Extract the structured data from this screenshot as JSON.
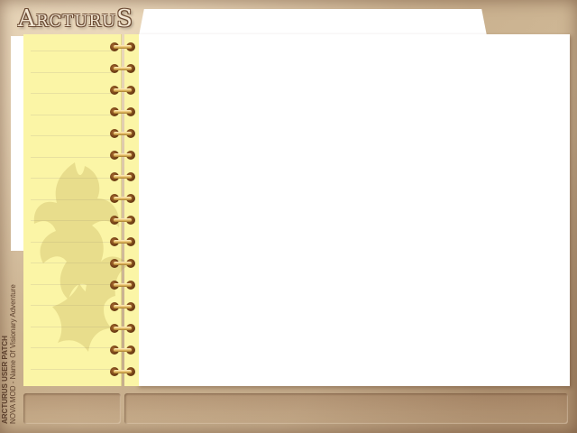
{
  "logo": {
    "text": "ArcturuS"
  },
  "side_label": {
    "line1": "ARCTURUS USER PATCH",
    "line2": "NOVA MOD - Name Of Visionary Adventure"
  },
  "colors": {
    "parchment": "#c7ae8c",
    "notepad": "#fbf5a6",
    "page": "#ffffff",
    "ring_gold": "#e9c16a",
    "ring_hole": "#6e3d14"
  },
  "icons": {
    "spiral": "spiral-ring-icon",
    "watermark": "crest-watermark-icon"
  }
}
